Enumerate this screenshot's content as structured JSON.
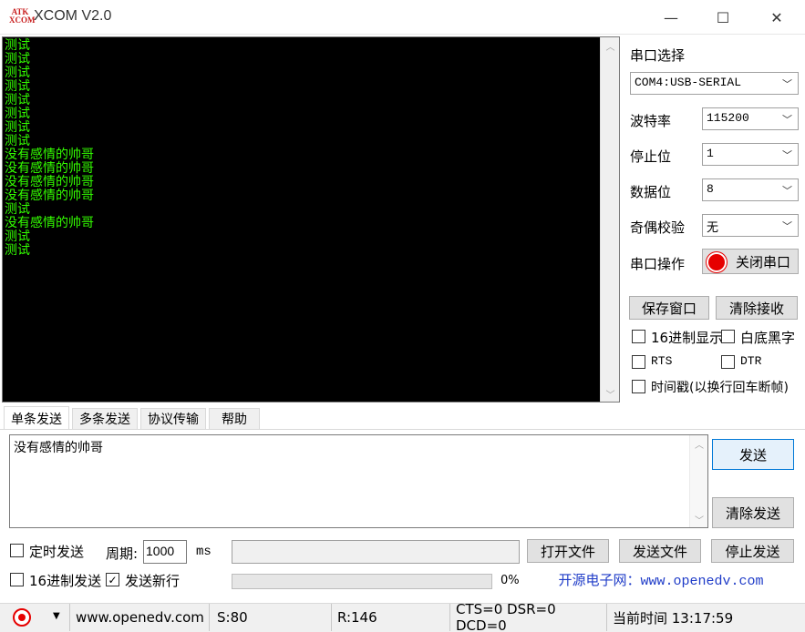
{
  "window": {
    "logo_line1": "ATK",
    "logo_line2": "XCOM",
    "title": "XCOM V2.0",
    "minimize": "—",
    "maximize": "☐",
    "close": "✕"
  },
  "receive": {
    "lines": [
      "测试",
      "测试",
      "测试",
      "测试",
      "测试",
      "测试",
      "测试",
      "测试",
      "没有感情的帅哥",
      "没有感情的帅哥",
      "没有感情的帅哥",
      "没有感情的帅哥",
      "测试",
      "没有感情的帅哥",
      "测试",
      "测试"
    ]
  },
  "panel": {
    "port_select_label": "串口选择",
    "port_value": "COM4:USB-SERIAL",
    "baud_label": "波特率",
    "baud_value": "115200",
    "stopbits_label": "停止位",
    "stopbits_value": "1",
    "databits_label": "数据位",
    "databits_value": "8",
    "parity_label": "奇偶校验",
    "parity_value": "无",
    "port_op_label": "串口操作",
    "close_port_button": "关闭串口",
    "save_window_button": "保存窗口",
    "clear_receive_button": "清除接收",
    "hex_display_label": "16进制显示",
    "white_bg_label": "白底黑字",
    "rts_label": "RTS",
    "dtr_label": "DTR",
    "timestamp_label": "时间戳(以换行回车断帧)",
    "indicator_color": "#e60000"
  },
  "tabs": [
    "单条发送",
    "多条发送",
    "协议传输",
    "帮助"
  ],
  "send": {
    "text": "没有感情的帅哥",
    "send_button": "发送",
    "clear_send_button": "清除发送",
    "timed_send_label": "定时发送",
    "period_label": "周期:",
    "period_value": "1000",
    "period_unit": "ms",
    "open_file_button": "打开文件",
    "send_file_button": "发送文件",
    "stop_send_button": "停止发送",
    "hex_send_label": "16进制发送",
    "send_newline_label": "发送新行",
    "send_newline_checked": true,
    "progress_percent": "0%",
    "website_banner": "开源电子网：www.openedv.com"
  },
  "status": {
    "url": "www.openedv.com",
    "sent": "S:80",
    "received": "R:146",
    "signals": "CTS=0 DSR=0 DCD=0",
    "time": "当前时间 13:17:59"
  }
}
